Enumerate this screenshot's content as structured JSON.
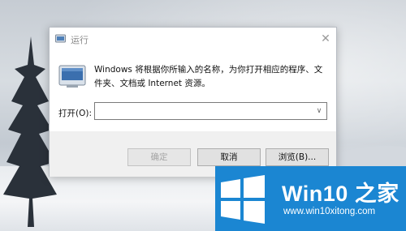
{
  "dialog": {
    "title": "运行",
    "description": "Windows 将根据你所输入的名称，为你打开相应的程序、文件夹、文档或 Internet 资源。",
    "open_label": "打开(O):",
    "open_value": "",
    "buttons": {
      "ok": "确定",
      "cancel": "取消",
      "browse": "浏览(B)..."
    }
  },
  "watermark": {
    "title": "Win10 之家",
    "url": "www.win10xitong.com",
    "color": "#1b86d2"
  }
}
